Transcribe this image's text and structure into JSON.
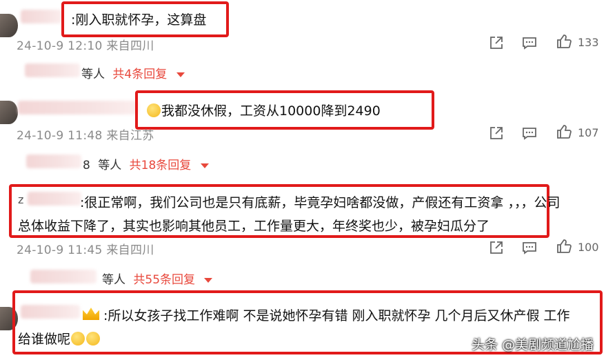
{
  "comments": [
    {
      "text": ":刚入职就怀孕，这算盘",
      "meta": "24-10-9 12:10 来自四川",
      "likes": "133",
      "replies_suffix": "等人",
      "replies_count": "共4条回复"
    },
    {
      "text": "我都没休假，工资从10000降到2490",
      "meta": "24-10-9 11:48 来自江苏",
      "likes": "107",
      "replies_prefix": "8",
      "replies_suffix": "等人",
      "replies_count": "共18条回复"
    },
    {
      "user_initial": "z",
      "text_line1": ":很正常啊，我们公司也是只有底薪，毕竟孕妇啥都没做，产假还有工资拿 ，，，公司",
      "text_line2": "总体收益下降了，其实也影响其他员工，工作量更大，年终奖也少，被孕妇瓜分了",
      "meta": "24-10-9 11:45 来自四川",
      "likes": "100",
      "replies_suffix": "等人",
      "replies_count": "共55条回复"
    },
    {
      "text_line1": ":所以女孩子找工作难啊 不是说她怀孕有错 刚入职就怀孕  几个月后又休产假 工作",
      "text_line2": "给谁做呢"
    }
  ],
  "watermark": "头条 @美剧频道尬播"
}
